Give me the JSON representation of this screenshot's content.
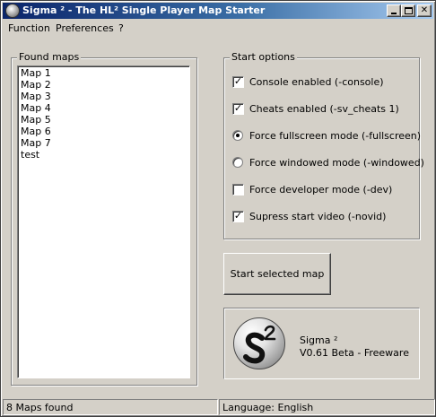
{
  "window": {
    "title": "Sigma ² - The HL² Single Player Map Starter"
  },
  "menu": [
    "Function",
    "Preferences",
    "?"
  ],
  "found_maps": {
    "label": "Found maps",
    "items": [
      "Map 1",
      "Map 2",
      "Map 3",
      "Map 4",
      "Map 5",
      "Map 6",
      "Map 7",
      "test"
    ]
  },
  "start_options": {
    "label": "Start options",
    "items": [
      {
        "type": "checkbox",
        "label": "Console enabled (-console)",
        "checked": true
      },
      {
        "type": "checkbox",
        "label": "Cheats enabled  (-sv_cheats 1)",
        "checked": true
      },
      {
        "type": "radio",
        "label": "Force fullscreen mode (-fullscreen)",
        "checked": true
      },
      {
        "type": "radio",
        "label": "Force windowed mode (-windowed)",
        "checked": false
      },
      {
        "type": "checkbox",
        "label": "Force developer mode (-dev)",
        "checked": false
      },
      {
        "type": "checkbox",
        "label": "Supress start video (-novid)",
        "checked": true
      }
    ]
  },
  "start_button": "Start selected map",
  "about": {
    "logo_icon": "sigma-squared-logo",
    "name": "Sigma ²",
    "version": "V0.61 Beta - Freeware"
  },
  "status": {
    "left": "8 Maps found",
    "right": "Language: English"
  }
}
